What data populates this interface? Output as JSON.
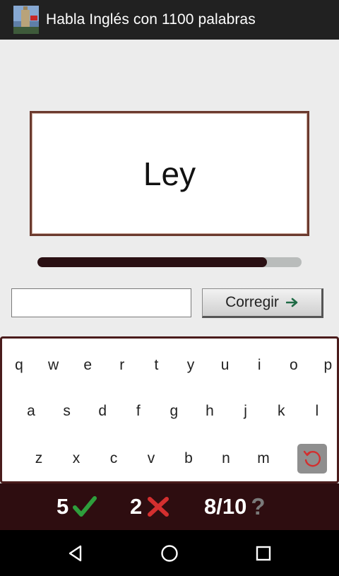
{
  "app": {
    "title": "Habla Inglés con 1100 palabras"
  },
  "card": {
    "word": "Ley"
  },
  "progress": {
    "fraction": 0.87
  },
  "answer": {
    "value": "",
    "placeholder": ""
  },
  "correct_button": {
    "label": "Corregir",
    "icon": "arrow-right-icon"
  },
  "keyboard": {
    "rows": [
      [
        "q",
        "w",
        "e",
        "r",
        "t",
        "y",
        "u",
        "i",
        "o",
        "p"
      ],
      [
        "a",
        "s",
        "d",
        "f",
        "g",
        "h",
        "j",
        "k",
        "l"
      ],
      [
        "z",
        "x",
        "c",
        "v",
        "b",
        "n",
        "m"
      ]
    ],
    "undo_icon": "undo-icon"
  },
  "score": {
    "correct": "5",
    "wrong": "2",
    "progress": "8/10"
  },
  "colors": {
    "card_border": "#6b3a2e",
    "progress_fill": "#2a1013",
    "score_bg": "#2e0d10",
    "check": "#2e9e3c",
    "cross": "#d32f2f",
    "question": "#7a7a7a"
  },
  "nav": {
    "icons": [
      "back-icon",
      "home-icon",
      "recents-icon"
    ]
  }
}
